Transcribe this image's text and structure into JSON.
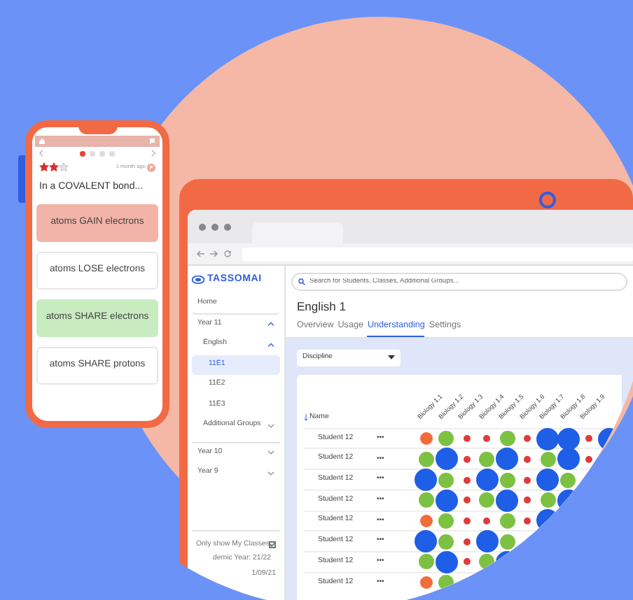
{
  "phone": {
    "pager": [
      {
        "selected": true
      },
      {
        "selected": false
      },
      {
        "selected": false
      },
      {
        "selected": false
      }
    ],
    "stars": 2,
    "time": "1 month ago",
    "question": "In a COVALENT bond...",
    "answers": [
      {
        "text": "atoms GAIN electrons",
        "kind": "wrong"
      },
      {
        "text": "atoms LOSE electrons",
        "kind": "plain"
      },
      {
        "text": "atoms SHARE electrons",
        "kind": "correct"
      },
      {
        "text": "atoms SHARE protons",
        "kind": "plain"
      }
    ]
  },
  "browser": {
    "logo": "TASSOMAI",
    "sidebar": {
      "home": "Home",
      "tree": [
        {
          "label": "Year 11",
          "expanded": true,
          "children": [
            {
              "label": "English",
              "expanded": true,
              "children": [
                {
                  "label": "11E1",
                  "selected": true
                },
                {
                  "label": "11E2",
                  "selected": false
                },
                {
                  "label": "11E3",
                  "selected": false
                }
              ]
            },
            {
              "label": "Additional Groups",
              "expanded": false
            }
          ]
        },
        {
          "label": "Year 10",
          "expanded": false
        },
        {
          "label": "Year 9",
          "expanded": false
        }
      ],
      "only_my_classes": {
        "label": "Only show My Classes",
        "checked": true
      },
      "academic_year": "demic Year: 21/22",
      "date": "1/09/21"
    },
    "search": {
      "placeholder": "Search for Students, Classes, Additional Groups..."
    },
    "title": "English 1",
    "tabs": [
      {
        "label": "Overview",
        "selected": false
      },
      {
        "label": "Usage",
        "selected": false
      },
      {
        "label": "Understanding",
        "selected": true
      },
      {
        "label": "Settings",
        "selected": false
      }
    ],
    "filter": "Discipline",
    "table": {
      "name_header": "Name",
      "topics": [
        "Biology 1.1",
        "Biology 1.2",
        "Biology 1.3",
        "Biology 1.4",
        "Biology 1.5",
        "Biology 1.6",
        "Biology 1.7",
        "Biology 1.8",
        "Biology 1.9"
      ],
      "rows": [
        {
          "name": "Student 12",
          "menu": "•••",
          "cells": [
            {
              "kind": "weak"
            },
            {
              "kind": "good"
            },
            {
              "kind": "low"
            },
            {
              "kind": "low"
            },
            {
              "kind": "good"
            },
            {
              "kind": "low"
            },
            {
              "kind": "strong"
            },
            {
              "kind": "strong"
            },
            {
              "kind": "low"
            },
            {
              "kind": "strong"
            }
          ]
        },
        {
          "name": "Student 12",
          "menu": "•••",
          "cells": [
            {
              "kind": "good"
            },
            {
              "kind": "strong"
            },
            {
              "kind": "low"
            },
            {
              "kind": "good"
            },
            {
              "kind": "strong"
            },
            {
              "kind": "low"
            },
            {
              "kind": "good"
            },
            {
              "kind": "strong"
            },
            {
              "kind": "low"
            }
          ]
        },
        {
          "name": "Student 12",
          "menu": "•••",
          "cells": [
            {
              "kind": "strong"
            },
            {
              "kind": "good"
            },
            {
              "kind": "low"
            },
            {
              "kind": "strong"
            },
            {
              "kind": "good"
            },
            {
              "kind": "low"
            },
            {
              "kind": "strong"
            },
            {
              "kind": "good"
            }
          ]
        },
        {
          "name": "Student 12",
          "menu": "•••",
          "cells": [
            {
              "kind": "good"
            },
            {
              "kind": "strong"
            },
            {
              "kind": "low"
            },
            {
              "kind": "good"
            },
            {
              "kind": "strong"
            },
            {
              "kind": "low"
            },
            {
              "kind": "good"
            },
            {
              "kind": "strong"
            }
          ]
        },
        {
          "name": "Student 12",
          "menu": "•••",
          "cells": [
            {
              "kind": "weak"
            },
            {
              "kind": "good"
            },
            {
              "kind": "low"
            },
            {
              "kind": "low"
            },
            {
              "kind": "good"
            },
            {
              "kind": "low"
            },
            {
              "kind": "strong"
            }
          ]
        },
        {
          "name": "Student 12",
          "menu": "•••",
          "cells": [
            {
              "kind": "strong"
            },
            {
              "kind": "good"
            },
            {
              "kind": "low"
            },
            {
              "kind": "strong"
            },
            {
              "kind": "good"
            }
          ]
        },
        {
          "name": "Student 12",
          "menu": "•••",
          "cells": [
            {
              "kind": "good"
            },
            {
              "kind": "strong"
            },
            {
              "kind": "low"
            },
            {
              "kind": "good"
            },
            {
              "kind": "strong"
            }
          ]
        },
        {
          "name": "Student 12",
          "menu": "•••",
          "cells": [
            {
              "kind": "weak"
            },
            {
              "kind": "good"
            }
          ]
        }
      ]
    }
  }
}
